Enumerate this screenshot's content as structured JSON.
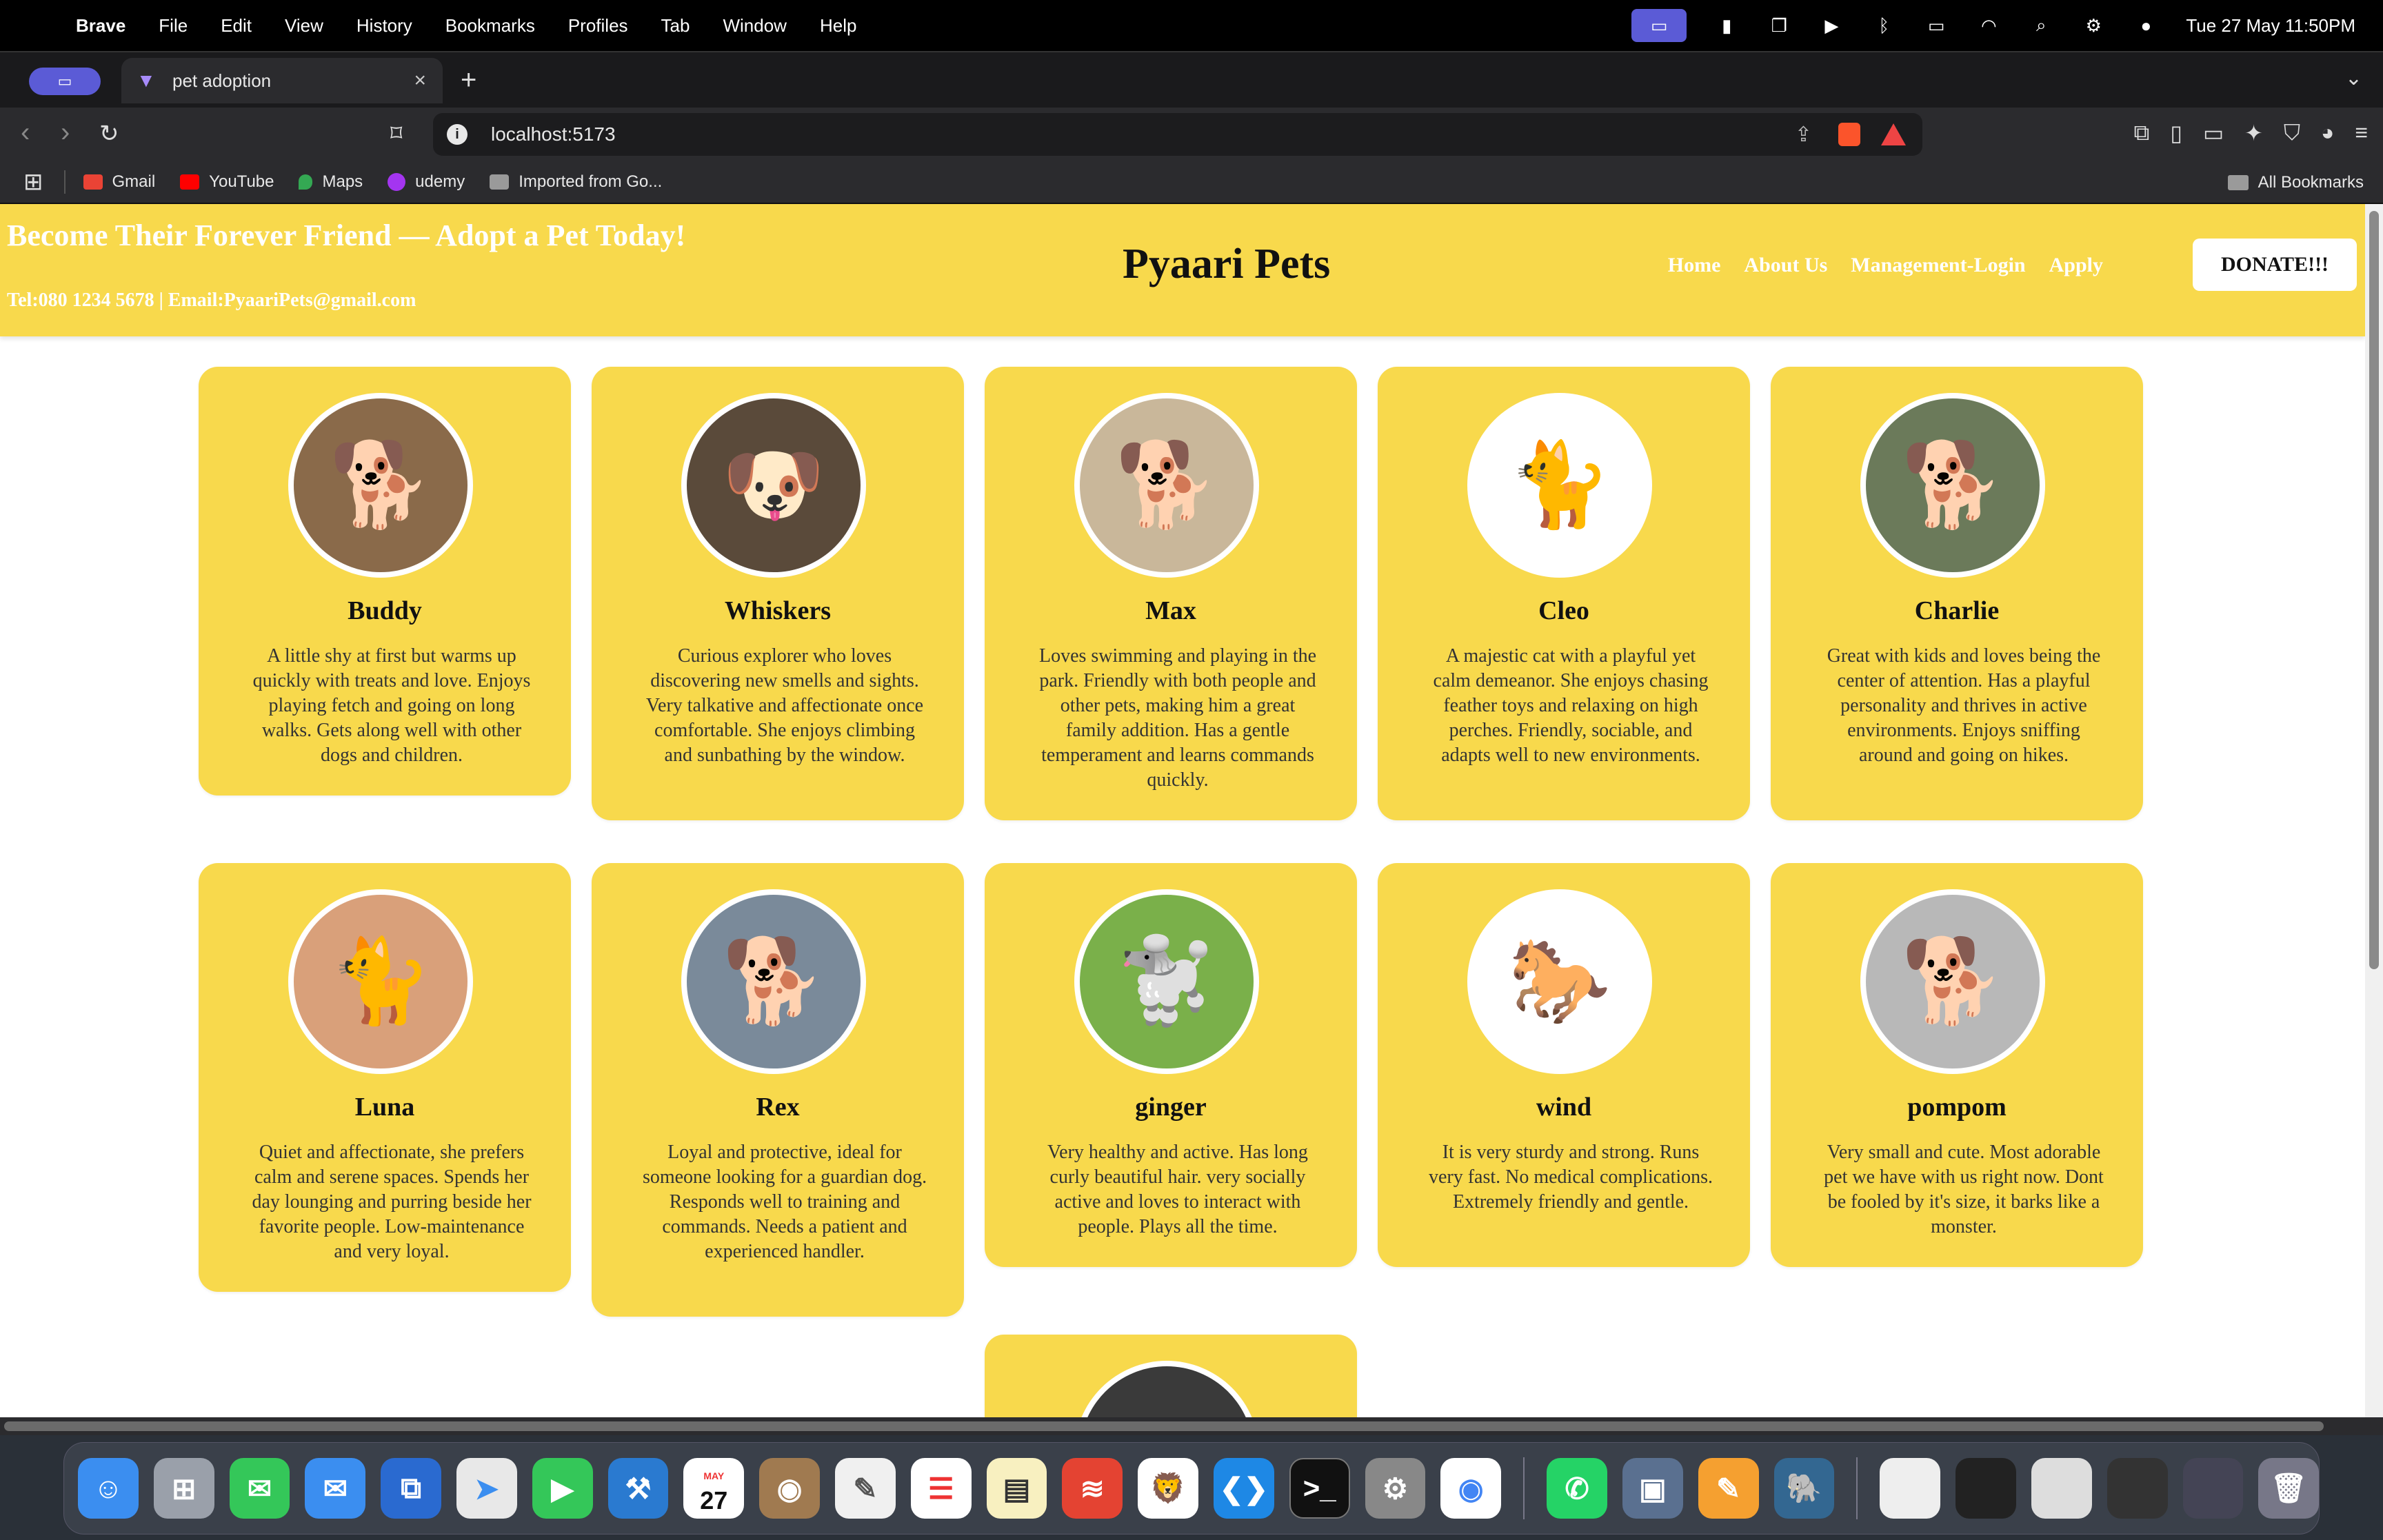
{
  "menubar": {
    "app_name": "Brave",
    "items": [
      "File",
      "Edit",
      "View",
      "History",
      "Bookmarks",
      "Profiles",
      "Tab",
      "Window",
      "Help"
    ],
    "datetime": "Tue 27 May  11:50PM"
  },
  "tab": {
    "title": "pet adoption"
  },
  "toolbar": {
    "url": "localhost:5173"
  },
  "bookmarks": {
    "items": [
      {
        "label": "Gmail",
        "color": "#ea4335"
      },
      {
        "label": "YouTube",
        "color": "#ff0000"
      },
      {
        "label": "Maps",
        "color": "#34a853"
      },
      {
        "label": "udemy",
        "color": "#a435f0"
      },
      {
        "label": "Imported from Go...",
        "color": "#9a9a9a"
      }
    ],
    "all_label": "All Bookmarks"
  },
  "site": {
    "tagline": "Become Their Forever Friend — Adopt a Pet Today!",
    "contact": "Tel:080 1234 5678 | Email:PyaariPets@gmail.com",
    "brand": "Pyaari Pets",
    "nav": [
      "Home",
      "About Us",
      "Management-Login",
      "Apply"
    ],
    "donate": "DONATE!!!",
    "accent": "#f8d94c"
  },
  "pets": [
    {
      "name": "Buddy",
      "desc": "A little shy at first but warms up quickly with treats and love. Enjoys playing fetch and going on long walks. Gets along well with other dogs and children.",
      "icon": "dog-with-glasses",
      "glyph": "🐕",
      "bg": "#8a6a4a"
    },
    {
      "name": "Whiskers",
      "desc": "Curious explorer who loves discovering new smells and sights. Very talkative and affectionate once comfortable. She enjoys climbing and sunbathing by the window.",
      "icon": "puppy",
      "glyph": "🐶",
      "bg": "#5a4a3a"
    },
    {
      "name": "Max",
      "desc": "Loves swimming and playing in the park. Friendly with both people and other pets, making him a great family addition. Has a gentle temperament and learns commands quickly.",
      "icon": "golden-puppy",
      "glyph": "🐕",
      "bg": "#c9b79a"
    },
    {
      "name": "Cleo",
      "desc": "A majestic cat with a playful yet calm demeanor. She enjoys chasing feather toys and relaxing on high perches. Friendly, sociable, and adapts well to new environments.",
      "icon": "cat",
      "glyph": "🐈",
      "bg": "#ffffff"
    },
    {
      "name": "Charlie",
      "desc": "Great with kids and loves being the center of attention. Has a playful personality and thrives in active environments. Enjoys sniffing around and going on hikes.",
      "icon": "beagle",
      "glyph": "🐕",
      "bg": "#6b7a5a"
    },
    {
      "name": "Luna",
      "desc": "Quiet and affectionate, she prefers calm and serene spaces. Spends her day lounging and purring beside her favorite people. Low-maintenance and very loyal.",
      "icon": "fluffy-cat",
      "glyph": "🐈",
      "bg": "#d9a07a"
    },
    {
      "name": "Rex",
      "desc": "Loyal and protective, ideal for someone looking for a guardian dog. Responds well to training and commands. Needs a patient and experienced handler.",
      "icon": "german-shepherd",
      "glyph": "🐕",
      "bg": "#7a8a9a"
    },
    {
      "name": "ginger",
      "desc": "Very healthy and active. Has long curly beautiful hair. very socially active and loves to interact with people. Plays all the time.",
      "icon": "poodle",
      "glyph": "🐩",
      "bg": "#7ab04a"
    },
    {
      "name": "wind",
      "desc": "It is very sturdy and strong. Runs very fast. No medical complications. Extremely friendly and gentle.",
      "icon": "horse",
      "glyph": "🐎",
      "bg": "#ffffff"
    },
    {
      "name": "pompom",
      "desc": "Very small and cute. Most adorable pet we have with us right now. Dont be fooled by it's size, it barks like a monster.",
      "icon": "pomeranian",
      "glyph": "🐕",
      "bg": "#b8b8b8"
    },
    {
      "name": "",
      "desc": "",
      "icon": "pet-photo",
      "glyph": "",
      "bg": "#3a3a3a"
    }
  ],
  "dock": {
    "calendar_month": "MAY",
    "calendar_day": "27"
  }
}
